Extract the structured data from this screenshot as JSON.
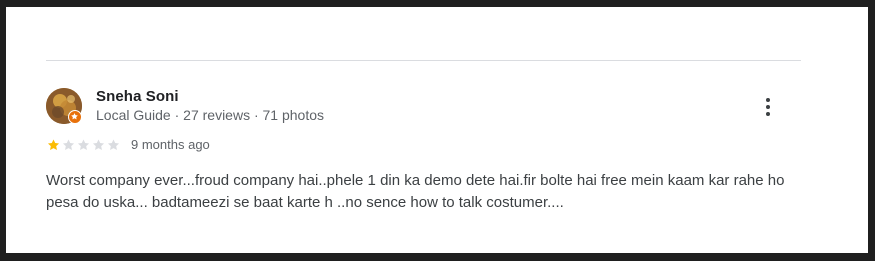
{
  "review": {
    "reviewer": {
      "name": "Sneha Soni",
      "meta": "Local Guide · 27 reviews · 71 photos",
      "badge_icon": "local-guide-star-icon",
      "badge_color": "#e8710a"
    },
    "rating": {
      "value": 1,
      "max": 5,
      "filled_color": "#fbbc04",
      "empty_color": "#dadce0"
    },
    "date": "9 months ago",
    "text": "Worst company ever...froud company hai..phele 1 din ka demo dete hai.fir bolte hai free mein kaam kar rahe ho pesa do uska... badtameezi se baat karte h ..no sence how to talk costumer....",
    "more_icon": "more-vert-icon"
  }
}
